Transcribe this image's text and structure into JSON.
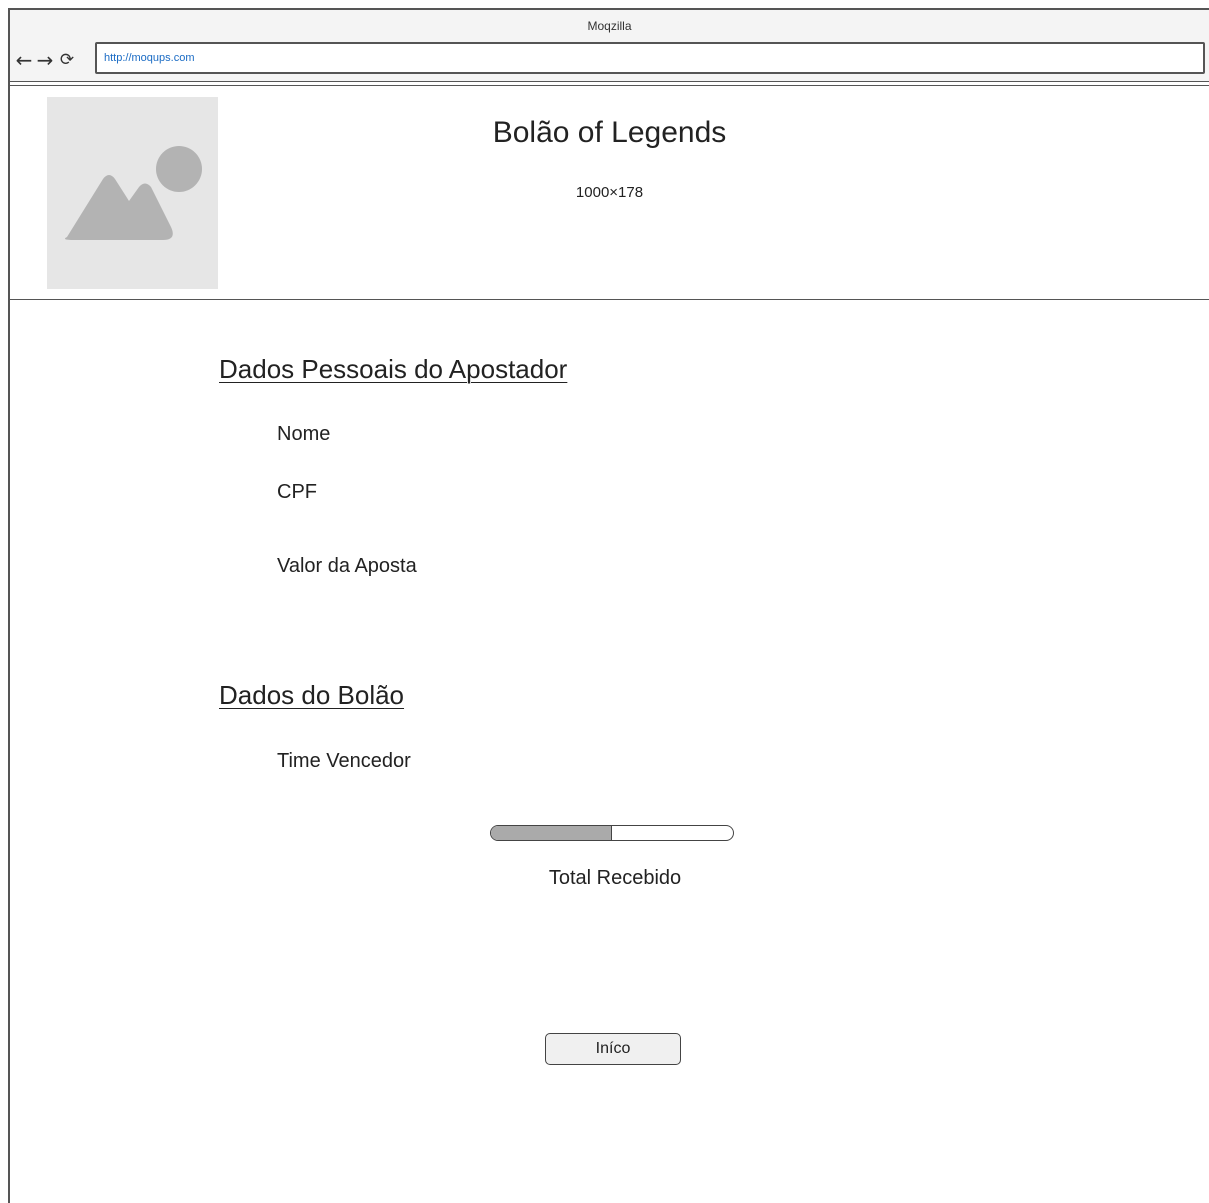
{
  "browser": {
    "title": "Moqzilla",
    "url": "http://moqups.com",
    "icons": {
      "back": "arrow-left-icon",
      "forward": "arrow-right-icon",
      "reload": "reload-icon"
    }
  },
  "header": {
    "image_icon": "image-placeholder-icon",
    "title": "Bolão of Legends",
    "image_dimensions": "1000×178"
  },
  "personal_section": {
    "heading": "Dados Pessoais do Apostador",
    "fields": [
      "Nome",
      "CPF",
      "Valor da Aposta"
    ]
  },
  "pool_section": {
    "heading": "Dados do Bolão",
    "fields": [
      "Time Vencedor"
    ],
    "progress": {
      "value_percent": 50,
      "label": "Total Recebido"
    }
  },
  "actions": {
    "inicio_label": "Iníco"
  },
  "colors": {
    "url_text": "#1a6bc4",
    "placeholder_bg": "#e6e6e6",
    "placeholder_icon": "#b3b3b3",
    "progress_fill": "#aaaaaa"
  }
}
